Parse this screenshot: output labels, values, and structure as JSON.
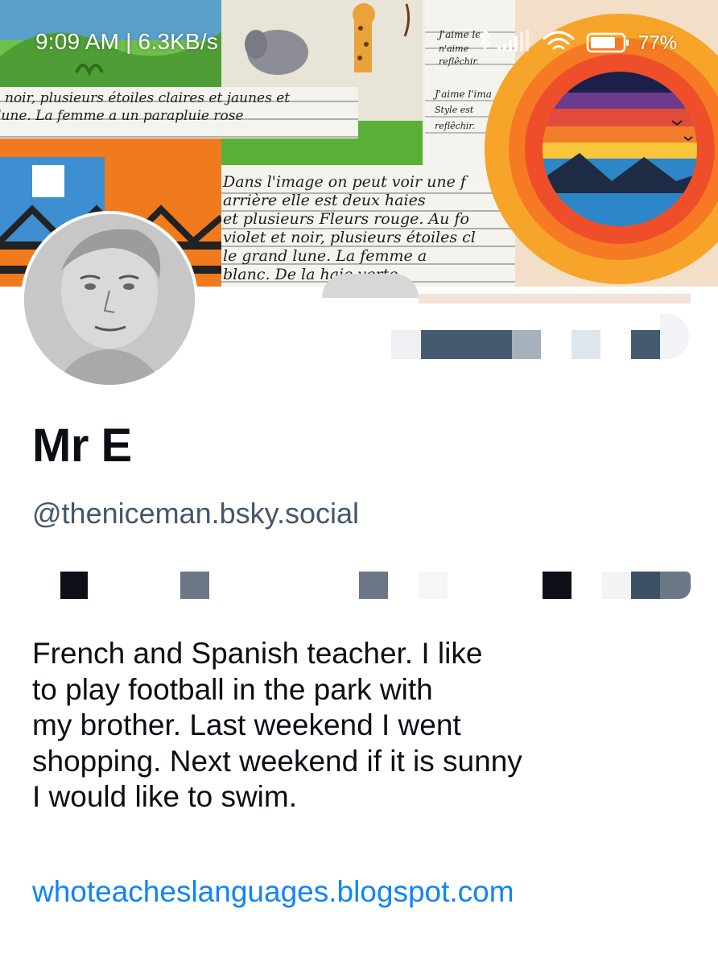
{
  "status_bar": {
    "time_speed": "9:09 AM | 6.3KB/s",
    "battery_percent": "77%",
    "icons": [
      "bluetooth-icon",
      "signal-icon",
      "wifi-icon",
      "battery-icon"
    ]
  },
  "banner": {
    "notes": {
      "top_left_1": "noir, plusieurs étoiles claires et jaunes et",
      "top_left_2": "lune. La femme a un parapluie rose",
      "top_right_1": "J'aime le",
      "top_right_2": "n'aime",
      "top_right_3": "reflêchir.",
      "right_1": "J'aime l'ima",
      "right_2": "Style est",
      "right_3": "reflêchir.",
      "mid_1": "Dans l'image on peut voir une f",
      "mid_2": "arrière elle est deux haies",
      "mid_3": "et plusieurs Fleurs rouge. Au fo",
      "mid_4": "violet et noir, plusieurs étoiles cl",
      "mid_5": "le grand lune. La femme a",
      "mid_6": "blanc. De la haie verte"
    }
  },
  "profile": {
    "display_name": "Mr E",
    "handle": "@theniceman.bsky.social",
    "bio_lines": [
      "French and Spanish teacher. I like",
      "to play football in the park with",
      "my brother. Last weekend I went",
      "shopping. Next weekend if it is sunny",
      "I would like to swim."
    ],
    "link": "whoteacheslanguages.blogspot.com"
  },
  "colors": {
    "accent_link": "#1083fe",
    "handle_gray": "#42576c",
    "text_dark": "#0b0f14"
  }
}
